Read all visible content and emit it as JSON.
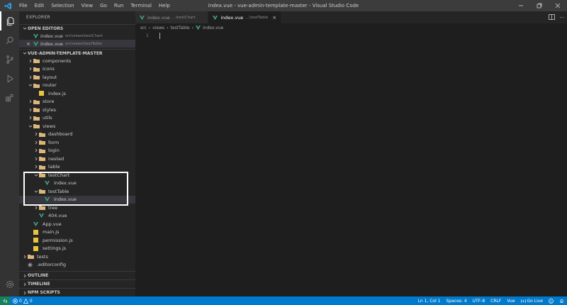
{
  "titlebar": {
    "menu": [
      "File",
      "Edit",
      "Selection",
      "View",
      "Go",
      "Run",
      "Terminal",
      "Help"
    ],
    "title": "index.vue - vue-admin-template-master - Visual Studio Code"
  },
  "sidebar": {
    "title": "EXPLORER",
    "open_editors": {
      "header": "OPEN EDITORS",
      "items": [
        {
          "name": "index.vue",
          "path": "src\\views\\testChart"
        },
        {
          "name": "index.vue",
          "path": "src\\views\\testTable"
        }
      ]
    },
    "project": {
      "header": "VUE-ADMIN-TEMPLATE-MASTER",
      "tree": [
        {
          "label": "components",
          "type": "folder",
          "depth": 1,
          "open": false
        },
        {
          "label": "icons",
          "type": "folder",
          "depth": 1,
          "open": false
        },
        {
          "label": "layout",
          "type": "folder",
          "depth": 1,
          "open": false
        },
        {
          "label": "router",
          "type": "folder",
          "depth": 1,
          "open": true
        },
        {
          "label": "index.js",
          "type": "js",
          "depth": 2
        },
        {
          "label": "store",
          "type": "folder",
          "depth": 1,
          "open": false
        },
        {
          "label": "styles",
          "type": "folder",
          "depth": 1,
          "open": false
        },
        {
          "label": "utils",
          "type": "folder",
          "depth": 1,
          "open": false
        },
        {
          "label": "views",
          "type": "folder",
          "depth": 1,
          "open": true
        },
        {
          "label": "dashboard",
          "type": "folder",
          "depth": 2,
          "open": false
        },
        {
          "label": "form",
          "type": "folder",
          "depth": 2,
          "open": false
        },
        {
          "label": "login",
          "type": "folder",
          "depth": 2,
          "open": false
        },
        {
          "label": "nested",
          "type": "folder",
          "depth": 2,
          "open": false
        },
        {
          "label": "table",
          "type": "folder",
          "depth": 2,
          "open": false
        },
        {
          "label": "testChart",
          "type": "folder",
          "depth": 2,
          "open": true
        },
        {
          "label": "index.vue",
          "type": "vue",
          "depth": 3
        },
        {
          "label": "testTable",
          "type": "folder",
          "depth": 2,
          "open": true
        },
        {
          "label": "index.vue",
          "type": "vue",
          "depth": 3,
          "selected": true
        },
        {
          "label": "tree",
          "type": "folder",
          "depth": 2,
          "open": false
        },
        {
          "label": "404.vue",
          "type": "vue",
          "depth": 2
        },
        {
          "label": "App.vue",
          "type": "vue",
          "depth": 1
        },
        {
          "label": "main.js",
          "type": "js",
          "depth": 1
        },
        {
          "label": "permission.js",
          "type": "js",
          "depth": 1
        },
        {
          "label": "settings.js",
          "type": "js",
          "depth": 1
        },
        {
          "label": "tests",
          "type": "folder",
          "depth": 0,
          "open": false
        },
        {
          "label": ".editorconfig",
          "type": "gear",
          "depth": 0
        }
      ]
    },
    "bottom_sections": [
      "OUTLINE",
      "TIMELINE",
      "NPM SCRIPTS"
    ]
  },
  "tabs": [
    {
      "name": "index.vue",
      "path": "...\\testChart",
      "active": false
    },
    {
      "name": "index.vue",
      "path": "...\\testTable",
      "active": true
    }
  ],
  "breadcrumb": [
    "src",
    "views",
    "testTable",
    "index.vue"
  ],
  "editor": {
    "line_number": "1"
  },
  "statusbar": {
    "errors": "0",
    "warnings": "0",
    "position": "Ln 1, Col 1",
    "spaces": "Spaces: 4",
    "encoding": "UTF-8",
    "eol": "CRLF",
    "language": "Vue",
    "golive": "Go Live"
  },
  "colors": {
    "vue": "#41b883",
    "folder": "#dcb67a",
    "js": "#e8c53b",
    "accent": "#007acc",
    "highlight": "#ffffff"
  }
}
